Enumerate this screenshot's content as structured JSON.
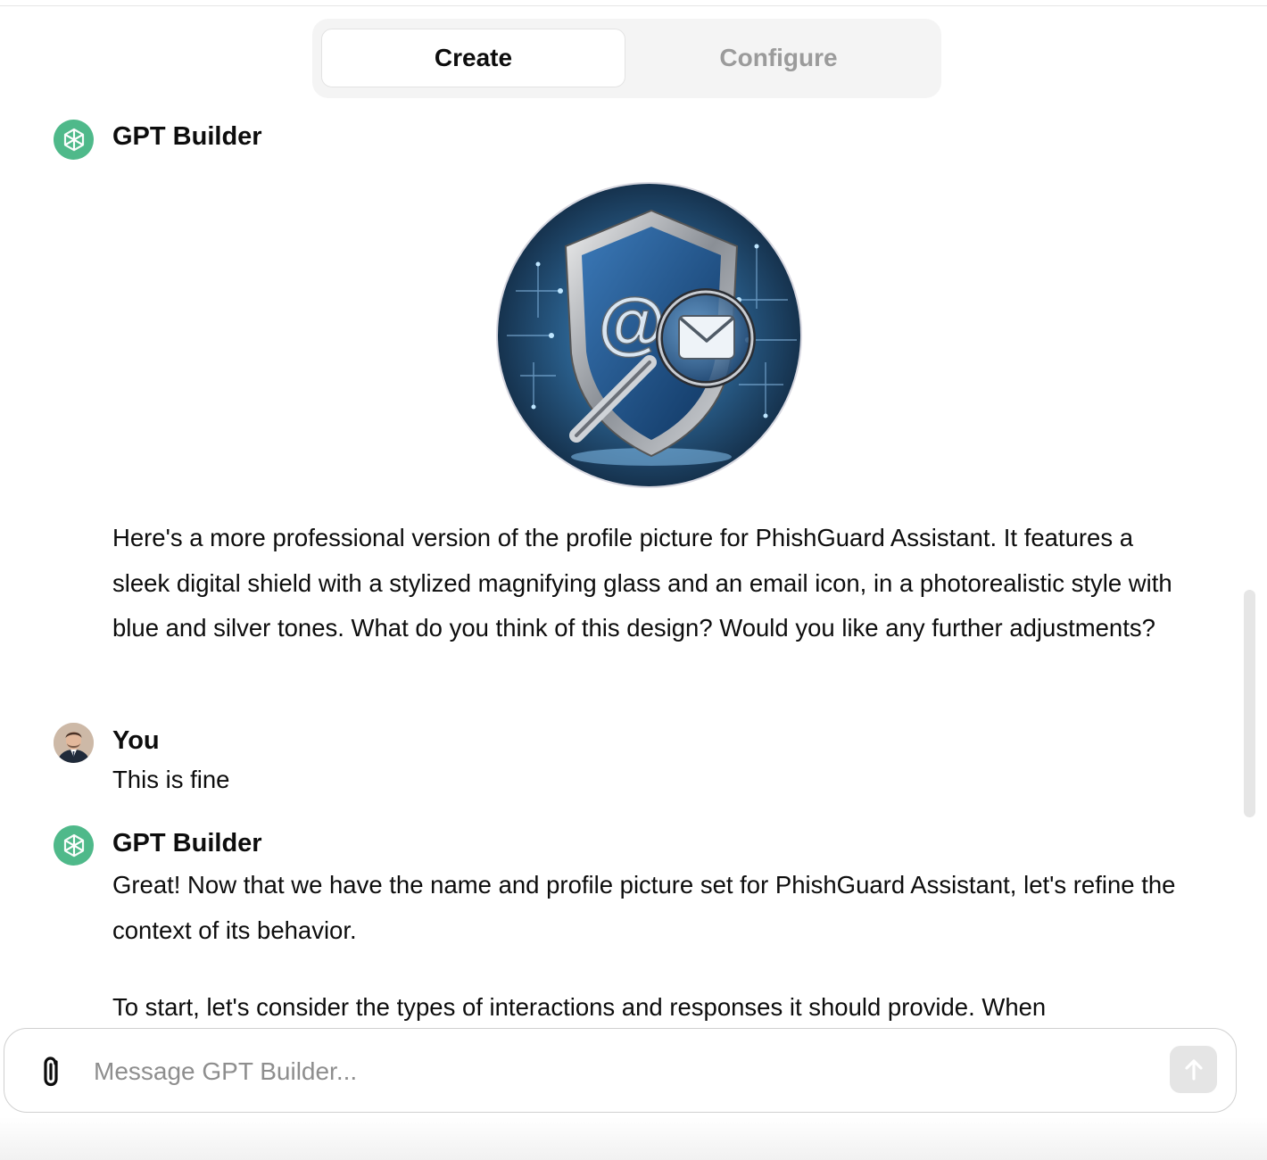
{
  "tabs": {
    "create_label": "Create",
    "configure_label": "Configure",
    "active": "Create"
  },
  "messages": [
    {
      "author": "GPT Builder",
      "paragraphs": [
        "Here's a more professional version of the profile picture for PhishGuard Assistant. It features a sleek digital shield with a stylized magnifying glass and an email icon, in a photorealistic style with blue and silver tones. What do you think of this design? Would you like any further adjustments?"
      ],
      "has_image": true
    },
    {
      "author": "You",
      "paragraphs": [
        "This is fine"
      ]
    },
    {
      "author": "GPT Builder",
      "paragraphs": [
        "Great! Now that we have the name and profile picture set for PhishGuard Assistant, let's refine the context of its behavior.",
        "To start, let's consider the types of interactions and responses it should provide. When"
      ]
    }
  ],
  "composer": {
    "placeholder": "Message GPT Builder...",
    "value": ""
  },
  "icons": {
    "gpt_avatar": "openai-logo-icon",
    "user_avatar": "user-photo-icon",
    "attach": "paperclip-icon",
    "send": "arrow-up-icon"
  },
  "colors": {
    "gpt_avatar_bg": "#4fb98a",
    "inactive_tab_text": "#9b9b9b",
    "send_button_bg": "#e5e5e5"
  }
}
